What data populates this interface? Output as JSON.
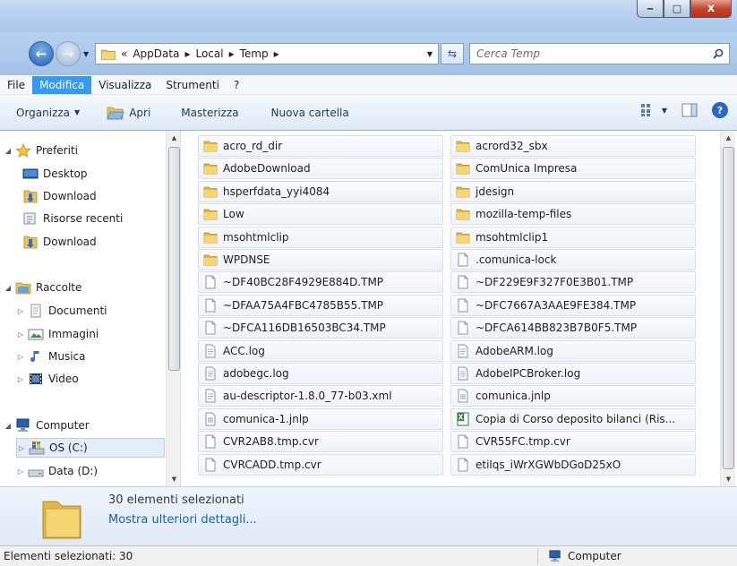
{
  "window": {
    "caption_minimize": "‒",
    "caption_maximize": "□",
    "caption_close": "x"
  },
  "address_bar": {
    "chevron": "«",
    "path": [
      "AppData",
      "Local",
      "Temp"
    ],
    "separator": "▸",
    "search_placeholder": "Cerca Temp"
  },
  "menu": [
    {
      "label": "File",
      "active": false
    },
    {
      "label": "Modifica",
      "active": true
    },
    {
      "label": "Visualizza",
      "active": false
    },
    {
      "label": "Strumenti",
      "active": false
    },
    {
      "label": "?",
      "active": false
    }
  ],
  "toolbar": {
    "organize": "Organizza",
    "open": "Apri",
    "burn": "Masterizza",
    "new_folder": "Nuova cartella",
    "help": "?"
  },
  "nav": {
    "favorites": "Preferiti",
    "desktop": "Desktop",
    "download1": "Download",
    "recent": "Risorse recenti",
    "download2": "Download",
    "libraries": "Raccolte",
    "documents": "Documenti",
    "pictures": "Immagini",
    "music": "Musica",
    "video": "Video",
    "computer": "Computer",
    "os_c": "OS (C:)",
    "data_d": "Data (D:)"
  },
  "files": [
    {
      "name": "acro_rd_dir",
      "icon": "folder-icon"
    },
    {
      "name": "acrord32_sbx",
      "icon": "folder-icon"
    },
    {
      "name": "AdobeDownload",
      "icon": "folder-icon"
    },
    {
      "name": "ComUnica Impresa",
      "icon": "folder-icon"
    },
    {
      "name": "hsperfdata_yyi4084",
      "icon": "folder-icon"
    },
    {
      "name": "jdesign",
      "icon": "folder-icon"
    },
    {
      "name": "Low",
      "icon": "folder-icon"
    },
    {
      "name": "mozilla-temp-files",
      "icon": "folder-icon"
    },
    {
      "name": "msohtmlclip",
      "icon": "folder-icon"
    },
    {
      "name": "msohtmlclip1",
      "icon": "folder-icon"
    },
    {
      "name": "WPDNSE",
      "icon": "folder-icon"
    },
    {
      "name": ".comunica-lock",
      "icon": "file-icon"
    },
    {
      "name": "~DF40BC28F4929E884D.TMP",
      "icon": "file-icon"
    },
    {
      "name": "~DF229E9F327F0E3B01.TMP",
      "icon": "file-icon"
    },
    {
      "name": "~DFAA75A4FBC4785B55.TMP",
      "icon": "file-icon"
    },
    {
      "name": "~DFC7667A3AAE9FE384.TMP",
      "icon": "file-icon"
    },
    {
      "name": "~DFCA116DB16503BC34.TMP",
      "icon": "file-icon"
    },
    {
      "name": "~DFCA614BB823B7B0F5.TMP",
      "icon": "file-icon"
    },
    {
      "name": "ACC.log",
      "icon": "text-file-icon"
    },
    {
      "name": "AdobeARM.log",
      "icon": "text-file-icon"
    },
    {
      "name": "adobegc.log",
      "icon": "text-file-icon"
    },
    {
      "name": "AdobeIPCBroker.log",
      "icon": "text-file-icon"
    },
    {
      "name": "au-descriptor-1.8.0_77-b03.xml",
      "icon": "text-file-icon"
    },
    {
      "name": "comunica.jnlp",
      "icon": "jnlp-file-icon"
    },
    {
      "name": "comunica-1.jnlp",
      "icon": "jnlp-file-icon"
    },
    {
      "name": "Copia di Corso deposito bilanci (Ris...",
      "icon": "excel-file-icon"
    },
    {
      "name": "CVR2AB8.tmp.cvr",
      "icon": "file-icon"
    },
    {
      "name": "CVR55FC.tmp.cvr",
      "icon": "file-icon"
    },
    {
      "name": "CVRCADD.tmp.cvr",
      "icon": "file-icon"
    },
    {
      "name": "etilqs_iWrXGWbDGoD25xO",
      "icon": "file-icon"
    }
  ],
  "details": {
    "count": "30 elementi selezionati",
    "more": "Mostra ulteriori dettagli..."
  },
  "status": {
    "left": "Elementi selezionati: 30",
    "right": "Computer"
  }
}
